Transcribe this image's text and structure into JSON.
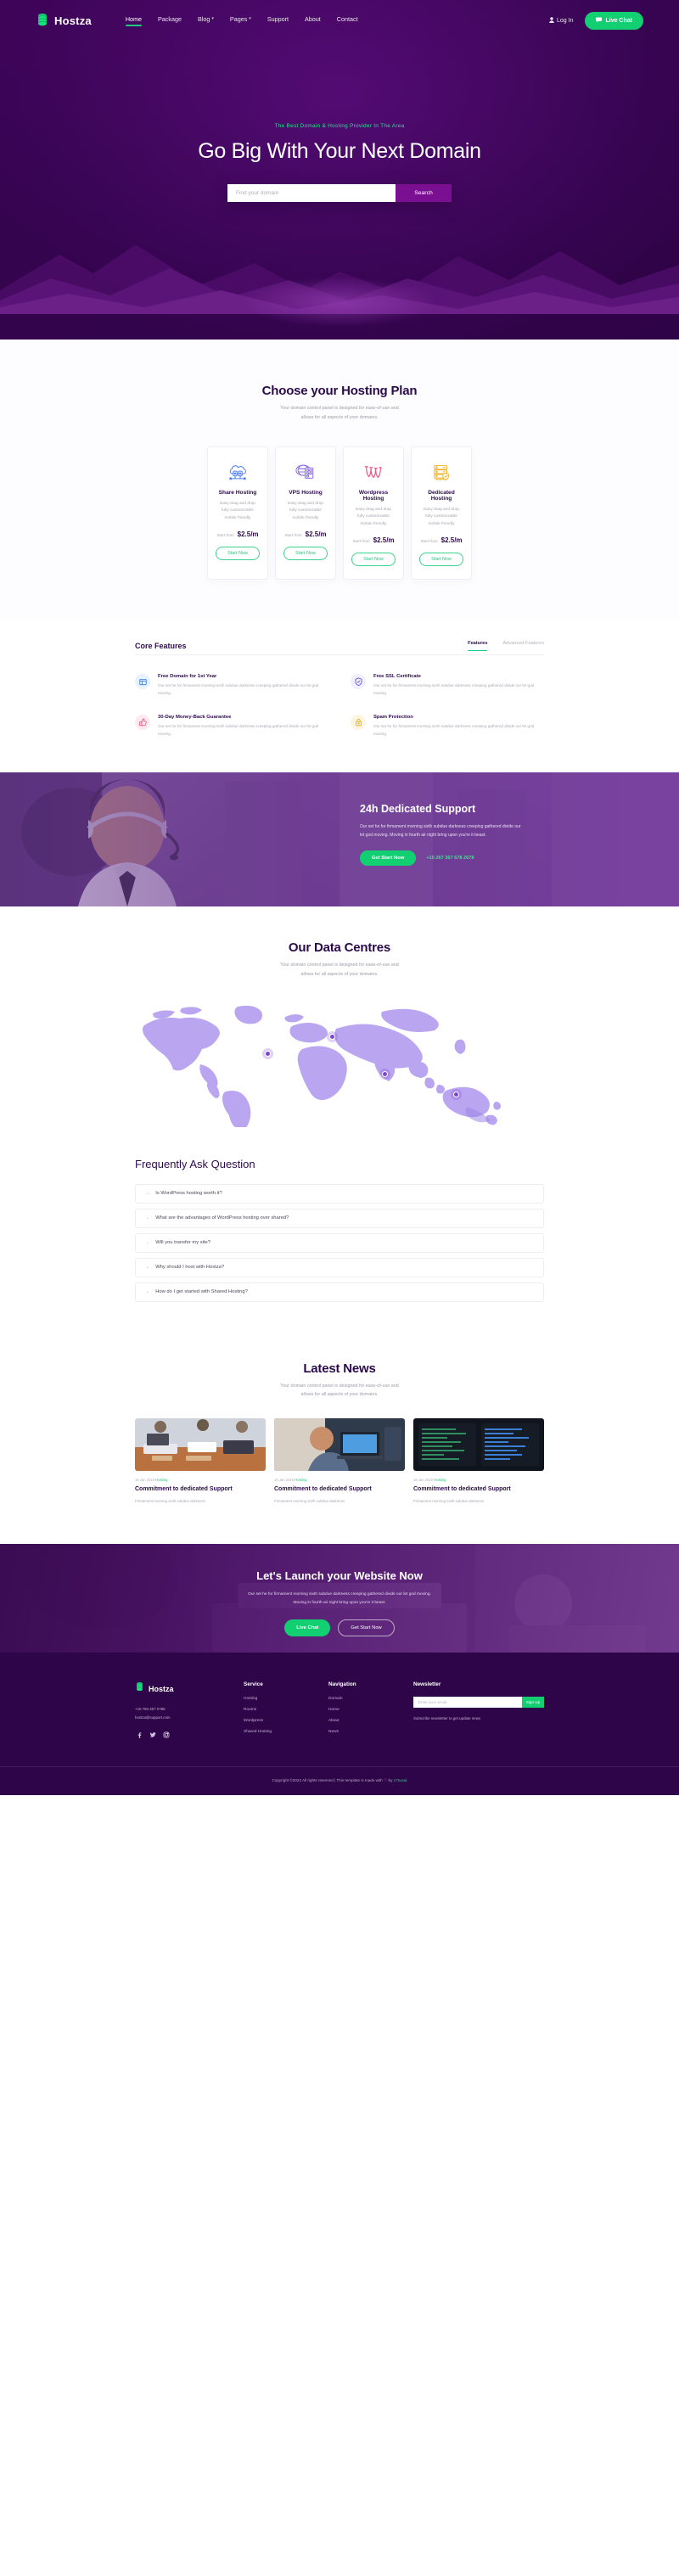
{
  "header": {
    "brand": "Hostza",
    "brand_logo_icon": "stacked-server-icon",
    "nav": [
      {
        "label": "Home",
        "active": true,
        "caret": false
      },
      {
        "label": "Package",
        "active": false,
        "caret": false
      },
      {
        "label": "Blog",
        "active": false,
        "caret": true
      },
      {
        "label": "Pages",
        "active": false,
        "caret": true
      },
      {
        "label": "Support",
        "active": false,
        "caret": false
      },
      {
        "label": "About",
        "active": false,
        "caret": false
      },
      {
        "label": "Contact",
        "active": false,
        "caret": false
      }
    ],
    "login_label": "Log In",
    "login_icon": "user-icon",
    "live_chat_label": "Live Chat",
    "live_chat_icon": "chat-bubble-icon"
  },
  "hero": {
    "eyebrow": "The Best Domain & Hosting Provider In The Area",
    "title": "Go Big With Your Next Domain",
    "search_placeholder": "Find your domain",
    "search_value": "",
    "search_button": "Search"
  },
  "pricing": {
    "title": "Choose your Hosting Plan",
    "desc_line1": "Your domain control panel is designed for ease-of-use and",
    "desc_line2": "allows for all aspects of your domains.",
    "cards": [
      {
        "icon": "cloud-server-icon",
        "icon_color": "#4a7df0",
        "title": "Share Hosting",
        "desc": "Easy drag and drop fully customizable mobile friendly",
        "from_label": "Start from",
        "price": "$2.5/m",
        "button": "Start Now"
      },
      {
        "icon": "globe-server-icon",
        "icon_color": "#8d6ce8",
        "title": "VPS Hosting",
        "desc": "Easy drag and drop fully customizable mobile friendly",
        "from_label": "Start from",
        "price": "$2.5/m",
        "button": "Start Now"
      },
      {
        "icon": "wordpress-w-icon",
        "icon_color": "#f1537f",
        "title": "Wordpress Hosting",
        "desc": "Easy drag and drop fully customizable mobile friendly",
        "from_label": "Start from",
        "price": "$2.5/m",
        "button": "Start Now"
      },
      {
        "icon": "server-shield-icon",
        "icon_color": "#f0b429",
        "title": "Dedicated Hosting",
        "desc": "Easy drag and drop fully customizable mobile friendly",
        "from_label": "Start from",
        "price": "$2.5/m",
        "button": "Start Now"
      }
    ]
  },
  "core_features": {
    "title": "Core Features",
    "tabs": [
      {
        "label": "Features",
        "active": true
      },
      {
        "label": "Advanced Features",
        "active": false
      }
    ],
    "items": [
      {
        "icon": "browser-window-icon",
        "icon_color": "#2f7ded",
        "icon_bg": "#e8f1fe",
        "name": "Free Domain for 1st Year",
        "text": "Our set he for firmament morning sixth subdue darkness creeping gathered divide our let god moving."
      },
      {
        "icon": "shield-check-icon",
        "icon_color": "#6b3fd4",
        "icon_bg": "#eef0fd",
        "name": "Free SSL Certificate",
        "text": "Our set he for firmament morning sixth subdue darkness creeping gathered divide our let god moving."
      },
      {
        "icon": "thumbs-up-icon",
        "icon_color": "#f04f7c",
        "icon_bg": "#fdeaf0",
        "name": "30-Day Money-Back Guarantee",
        "text": "Our set he for firmament morning sixth subdue darkness creeping gathered divide our let god moving."
      },
      {
        "icon": "lock-icon",
        "icon_color": "#e8a817",
        "icon_bg": "#fdf5e1",
        "name": "Spam Protection",
        "text": "Our set he for firmament morning sixth subdue darkness creeping gathered divide our let god moving."
      }
    ]
  },
  "support": {
    "title": "24h Dedicated Support",
    "text": "Our set he for firmament morning sixth subdue darkness creeping gathered divide our let god moving. Moving in fourth air night bring upon you're it beast.",
    "button": "Get Start Now",
    "phone": "+10 267 367 678 2678"
  },
  "data_centres": {
    "title": "Our Data Centres",
    "desc_line1": "Your domain control panel is designed for ease-of-use and",
    "desc_line2": "allows for all aspects of your domains."
  },
  "faq": {
    "title": "Frequently Ask Question",
    "items": [
      {
        "question": "Is WordPress hosting worth it?",
        "icon": "chevron-down-icon"
      },
      {
        "question": "What are the advantages of WordPress hosting over shared?",
        "icon": "chevron-down-icon"
      },
      {
        "question": "Will you transfer my site?",
        "icon": "chevron-down-icon"
      },
      {
        "question": "Why should I host with Hostza?",
        "icon": "chevron-down-icon"
      },
      {
        "question": "How do I get started with Shared Hosting?",
        "icon": "chevron-down-icon"
      }
    ]
  },
  "news": {
    "title": "Latest News",
    "desc_line1": "Your domain control panel is designed for ease-of-use and",
    "desc_line2": "allows for all aspects of your domains.",
    "cards": [
      {
        "date": "16 Jan 2019",
        "tag": "Hosting",
        "title": "Commitment to dedicated Support",
        "text": "Firmament morning sixth subdue darkness"
      },
      {
        "date": "16 Jan 2019",
        "tag": "Hosting",
        "title": "Commitment to dedicated Support",
        "text": "Firmament morning sixth subdue darkness"
      },
      {
        "date": "16 Jan 2019",
        "tag": "Hosting",
        "title": "Commitment to dedicated Support",
        "text": "Firmament morning sixth subdue darkness"
      }
    ]
  },
  "cta": {
    "title": "Let's Launch your Website Now",
    "text_line1": "Our set he for firmament morning sixth subdue darkness creeping gathered divide our let god moving.",
    "text_line2": "Moving in fourth air night bring upon you're it beast.",
    "button_primary": "Live Chat",
    "button_secondary": "Get Start Now"
  },
  "footer": {
    "brand": "Hostza",
    "phone": "+10 783 467 0785",
    "email": "hostza@support.com",
    "social": [
      "facebook-icon",
      "twitter-icon",
      "instagram-icon"
    ],
    "service": {
      "heading": "Service",
      "items": [
        "Hosting",
        "Rooms",
        "Wordpress",
        "Shared Hosting"
      ]
    },
    "navigation": {
      "heading": "Navigation",
      "items": [
        "Domain",
        "Home",
        "About",
        "News"
      ]
    },
    "newsletter": {
      "heading": "Newsletter",
      "placeholder": "Enter your email",
      "value": "",
      "button": "Sign Up",
      "note": "Subscribe newsletter to get update news"
    },
    "copyright_prefix": "Copyright ©2022 All rights reserved | This template is made with ",
    "copyright_heart": "♡",
    "copyright_by": " by ",
    "copyright_link": "17sucai"
  },
  "colors": {
    "brand_purple": "#2e0549",
    "accent_green": "#12cf72",
    "deep_purple": "#3d0457",
    "search_button": "#7a0f91"
  }
}
